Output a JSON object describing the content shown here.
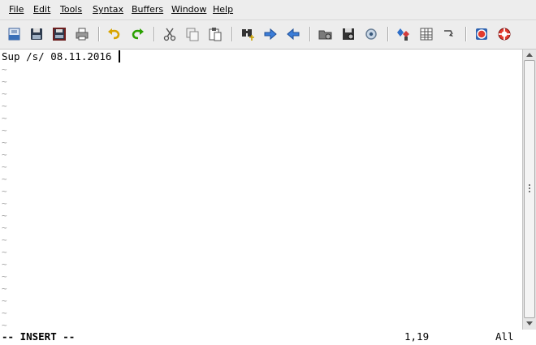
{
  "menubar": {
    "items": [
      {
        "label": "File"
      },
      {
        "label": "Edit"
      },
      {
        "label": "Tools"
      },
      {
        "label": "Syntax"
      },
      {
        "label": "Buffers"
      },
      {
        "label": "Window"
      },
      {
        "label": "Help"
      }
    ]
  },
  "toolbar": {
    "buttons": [
      "open-file-icon",
      "save-icon",
      "save-all-icon",
      "print-icon",
      "undo-icon",
      "redo-icon",
      "cut-icon",
      "copy-icon",
      "paste-icon",
      "find-replace-icon",
      "find-next-icon",
      "find-previous-icon",
      "load-session-icon",
      "save-session-icon",
      "run-script-icon",
      "make-icon",
      "shell-icon",
      "jump-to-tag-icon",
      "help-icon",
      "find-help-icon"
    ]
  },
  "editor": {
    "lines": [
      "Sup /s/ 08.11.2016"
    ],
    "empty_line_marker": "~"
  },
  "status": {
    "mode": "-- INSERT --",
    "position": "1,19",
    "scroll": "All"
  },
  "colors": {
    "menubar_bg": "#ededed",
    "editor_bg": "#ffffff",
    "tilde": "#a0a0a0"
  }
}
